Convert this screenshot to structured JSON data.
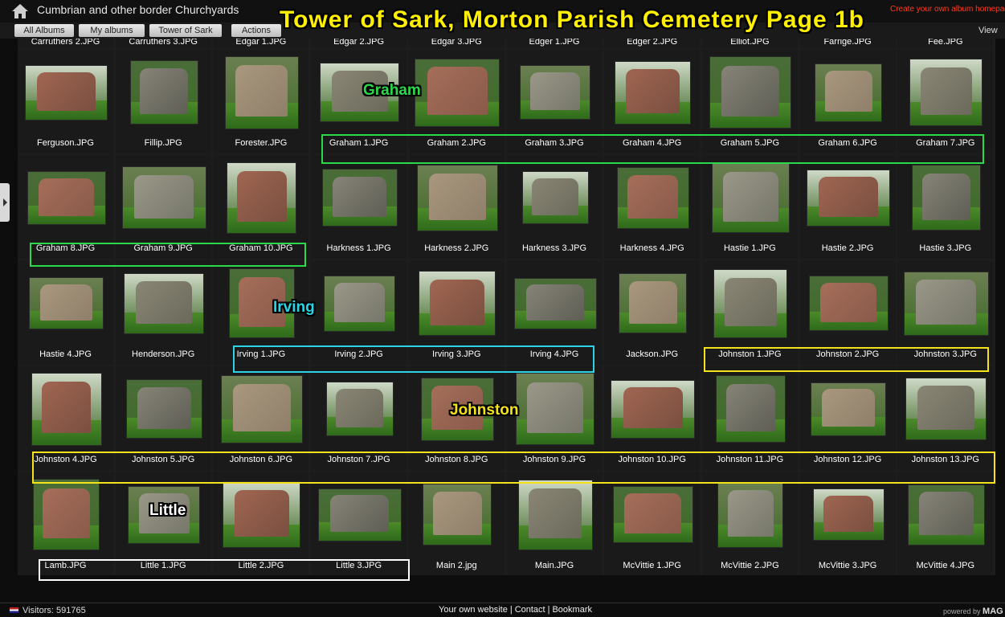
{
  "header": {
    "album_title": "Cumbrian and other border Churchyards",
    "create_link": "Create your own album homepag",
    "overlay_title": "Tower of Sark, Morton Parish Cemetery  Page 1b"
  },
  "nav": {
    "breadcrumbs": [
      "All Albums",
      "My albums",
      "Tower of Sark",
      "Actions"
    ],
    "view_label": "View"
  },
  "top_partial_row": [
    "Carruthers 2.JPG",
    "Carruthers 3.JPG",
    "Edgar 1.JPG",
    "Edgar 2.JPG",
    "Edgar 3.JPG",
    "Edger 1.JPG",
    "Edger 2.JPG",
    "Elliot.JPG",
    "Farrige.JPG",
    "Fee.JPG"
  ],
  "rows": [
    [
      "Ferguson.JPG",
      "Fillip.JPG",
      "Forester.JPG",
      "Graham 1.JPG",
      "Graham 2.JPG",
      "Graham 3.JPG",
      "Graham 4.JPG",
      "Graham 5.JPG",
      "Graham 6.JPG",
      "Graham 7.JPG"
    ],
    [
      "Graham 8.JPG",
      "Graham 9.JPG",
      "Graham 10.JPG",
      "Harkness 1.JPG",
      "Harkness 2.JPG",
      "Harkness 3.JPG",
      "Harkness 4.JPG",
      "Hastie 1.JPG",
      "Hastie 2.JPG",
      "Hastie 3.JPG"
    ],
    [
      "Hastie 4.JPG",
      "Henderson.JPG",
      "Irving 1.JPG",
      "Irving 2.JPG",
      "Irving 3.JPG",
      "Irving 4.JPG",
      "Jackson.JPG",
      "Johnston 1.JPG",
      "Johnston 2.JPG",
      "Johnston 3.JPG"
    ],
    [
      "Johnston 4.JPG",
      "Johnston 5.JPG",
      "Johnston 6.JPG",
      "Johnston 7.JPG",
      "Johnston 8.JPG",
      "Johnston 9.JPG",
      "Johnston 10.JPG",
      "Johnston 11.JPG",
      "Johnston 12.JPG",
      "Johnston 13.JPG"
    ],
    [
      "Lamb.JPG",
      "Little 1.JPG",
      "Little 2.JPG",
      "Little 3.JPG",
      "Main 2.jpg",
      "Main.JPG",
      "McVittie 1.JPG",
      "McVittie 2.JPG",
      "McVittie 3.JPG",
      "McVittie 4.JPG"
    ]
  ],
  "group_labels": {
    "graham": "Graham",
    "irving": "Irving",
    "johnston": "Johnston",
    "little": "Little"
  },
  "group_colors": {
    "graham": "#2bd94a",
    "irving": "#2ad4e6",
    "johnston": "#f4e21a",
    "little": "#ffffff"
  },
  "footer": {
    "visitors": "Visitors: 591765",
    "links": [
      "Your own website",
      "Contact",
      "Bookmark"
    ],
    "powered_by": "powered by",
    "powered_brand": "MAG"
  }
}
